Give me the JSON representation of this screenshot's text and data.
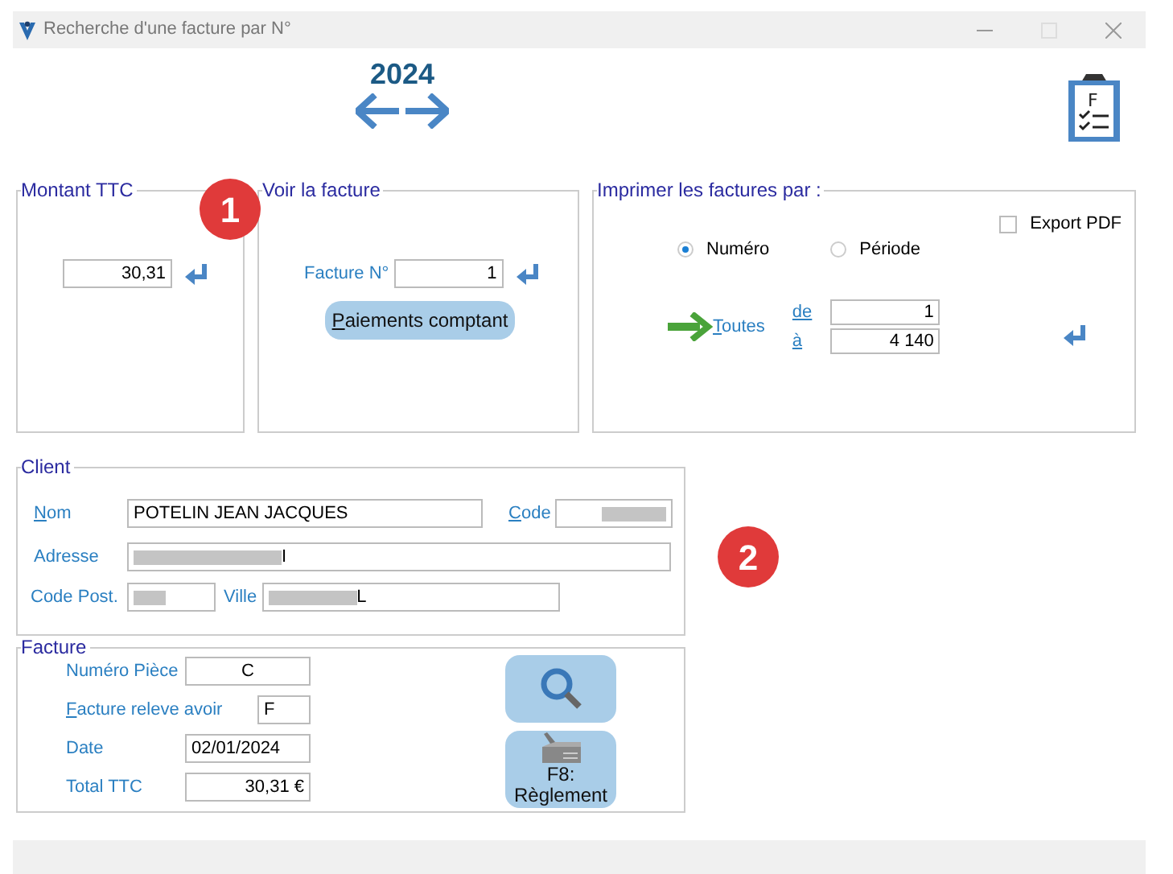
{
  "window": {
    "title": "Recherche d'une facture par N°"
  },
  "year": "2024",
  "clipboard_letter": "F",
  "montant_ttc": {
    "title": "Montant TTC",
    "value": "30,31"
  },
  "voir_facture": {
    "title": "Voir la facture",
    "label": "Facture N°",
    "value": "1",
    "button": {
      "label": "Paiements comptant",
      "accel": true
    }
  },
  "imprimer": {
    "title": "Imprimer les factures par :",
    "export_pdf": {
      "label": "Export PDF",
      "checked": false
    },
    "radios": [
      {
        "label": "Numéro",
        "selected": true
      },
      {
        "label": "Période",
        "selected": false
      }
    ],
    "toutes": {
      "label": "Toutes",
      "accel": true
    },
    "range": [
      {
        "label": "de",
        "value": "1"
      },
      {
        "label": "à",
        "value": "4 140"
      }
    ]
  },
  "client": {
    "title": "Client",
    "fields": [
      {
        "label": "Nom",
        "value": "POTELIN JEAN JACQUES",
        "accel": true,
        "redacted": false
      },
      {
        "label": "Code",
        "accel": true,
        "redacted": true
      },
      {
        "label": "Adresse",
        "value": "I",
        "accel": false,
        "redacted": true
      },
      {
        "label": "Code Post.",
        "accel": false,
        "redacted": true
      },
      {
        "label": "Ville",
        "value": "L",
        "accel": false,
        "redacted": true
      }
    ]
  },
  "facture": {
    "title": "Facture",
    "fields": [
      {
        "label": "Numéro Pièce",
        "value": "C",
        "accel": false
      },
      {
        "label": "Facture releve avoir",
        "value": "F",
        "accel": true
      },
      {
        "label": "Date",
        "value": "02/01/2024",
        "accel": false
      },
      {
        "label": "Total TTC",
        "value": "30,31 €",
        "accel": false
      }
    ],
    "reglement_button": "F8: Règlement"
  },
  "badges": [
    "1",
    "2"
  ]
}
